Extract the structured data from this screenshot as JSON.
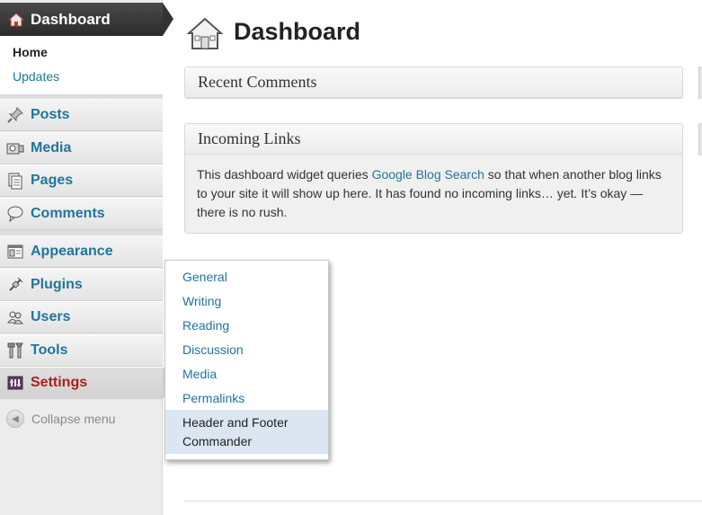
{
  "sidebar": {
    "dashboard_label": "Dashboard",
    "dashboard_sub": [
      {
        "label": "Home"
      },
      {
        "label": "Updates"
      }
    ],
    "items": [
      {
        "label": "Posts",
        "icon": "pin-icon"
      },
      {
        "label": "Media",
        "icon": "media-icon"
      },
      {
        "label": "Pages",
        "icon": "pages-icon"
      },
      {
        "label": "Comments",
        "icon": "comments-icon"
      },
      {
        "label": "Appearance",
        "icon": "appearance-icon"
      },
      {
        "label": "Plugins",
        "icon": "plugins-icon"
      },
      {
        "label": "Users",
        "icon": "users-icon"
      },
      {
        "label": "Tools",
        "icon": "tools-icon"
      },
      {
        "label": "Settings",
        "icon": "settings-icon"
      }
    ],
    "collapse_label": "Collapse menu"
  },
  "main": {
    "title": "Dashboard",
    "widgets": [
      {
        "title": "Recent Comments"
      },
      {
        "title": "Incoming Links",
        "body_pre": "This dashboard widget queries ",
        "body_link": "Google Blog Search",
        "body_post": " so that when another blog links to your site it will show up here. It has found no incoming links… yet. It’s okay — there is no rush."
      }
    ]
  },
  "settings_flyout": {
    "items": [
      "General",
      "Writing",
      "Reading",
      "Discussion",
      "Media",
      "Permalinks",
      "Header and Footer Commander"
    ]
  },
  "colors": {
    "link": "#21759b",
    "active_settings": "#b01c1c",
    "header_dark": "#333333",
    "highlight": "#dbe6f2"
  }
}
